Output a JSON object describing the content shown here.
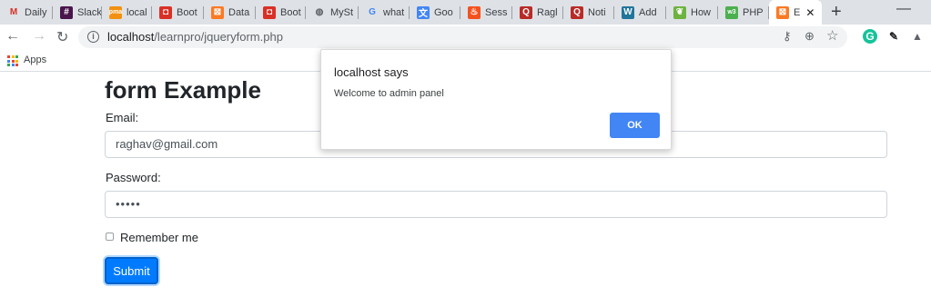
{
  "browser": {
    "tabs": [
      {
        "label": "Daily",
        "icon": "gmail-icon",
        "color": "#d93025",
        "glyph": "M"
      },
      {
        "label": "Slack",
        "icon": "slack-icon",
        "color": "#4a154b",
        "glyph": "#"
      },
      {
        "label": "local",
        "icon": "phpmyadmin-icon",
        "color": "#f29111",
        "glyph": "pma"
      },
      {
        "label": "Boot",
        "icon": "bootstrap-icon",
        "color": "#d93025",
        "glyph": "◘"
      },
      {
        "label": "Data",
        "icon": "xampp-icon",
        "color": "#fb7a24",
        "glyph": "⊠"
      },
      {
        "label": "Boot",
        "icon": "bootstrap-icon",
        "color": "#d93025",
        "glyph": "◘"
      },
      {
        "label": "MySt",
        "icon": "globe-icon",
        "color": "#5f6368",
        "glyph": "◍"
      },
      {
        "label": "what",
        "icon": "google-icon",
        "color": "#4285f4",
        "glyph": "G"
      },
      {
        "label": "Goo",
        "icon": "google-translate-icon",
        "color": "#4285f4",
        "glyph": "文"
      },
      {
        "label": "Sess",
        "icon": "fire-icon",
        "color": "#f4511e",
        "glyph": "♨"
      },
      {
        "label": "Ragl",
        "icon": "quora-icon",
        "color": "#b92b27",
        "glyph": "Q"
      },
      {
        "label": "Noti",
        "icon": "quora-icon",
        "color": "#b92b27",
        "glyph": "Q"
      },
      {
        "label": "Add",
        "icon": "wordpress-icon",
        "color": "#21759b",
        "glyph": "W"
      },
      {
        "label": "How",
        "icon": "leaf-icon",
        "color": "#6db33f",
        "glyph": "❦"
      },
      {
        "label": "PHP",
        "icon": "w3schools-icon",
        "color": "#4caf50",
        "glyph": "w3"
      },
      {
        "label": "E",
        "icon": "xampp-icon",
        "color": "#fb7a24",
        "glyph": "⊠"
      }
    ],
    "new_tab": "+",
    "minimize": "—",
    "back": "←",
    "forward": "→",
    "reload": "↻",
    "url_host": "localhost",
    "url_path": "/learnpro/jqueryform.php",
    "omnibox_icons": {
      "key": "⚷",
      "zoom": "⊕",
      "star": "☆"
    },
    "extensions": [
      {
        "name": "grammarly-icon",
        "glyph": "G",
        "color": "#15c39a"
      },
      {
        "name": "pen-icon",
        "glyph": "✎",
        "color": "#202124"
      },
      {
        "name": "drive-icon",
        "glyph": "▲",
        "color": "#5f6368"
      }
    ],
    "bookmarks": {
      "apps_label": "Apps"
    },
    "apps_colors": [
      "#ea4335",
      "#fbbc05",
      "#34a853",
      "#4285f4",
      "#ea4335",
      "#fbbc05",
      "#34a853",
      "#4285f4",
      "#ea4335"
    ]
  },
  "form": {
    "heading": "form Example",
    "email_label": "Email:",
    "email_value": "raghav@gmail.com",
    "password_label": "Password:",
    "password_value": "•••••",
    "remember_label": "Remember me",
    "remember_checked": false,
    "submit_label": "Submit"
  },
  "dialog": {
    "title": "localhost says",
    "message": "Welcome to admin panel",
    "ok_label": "OK"
  }
}
